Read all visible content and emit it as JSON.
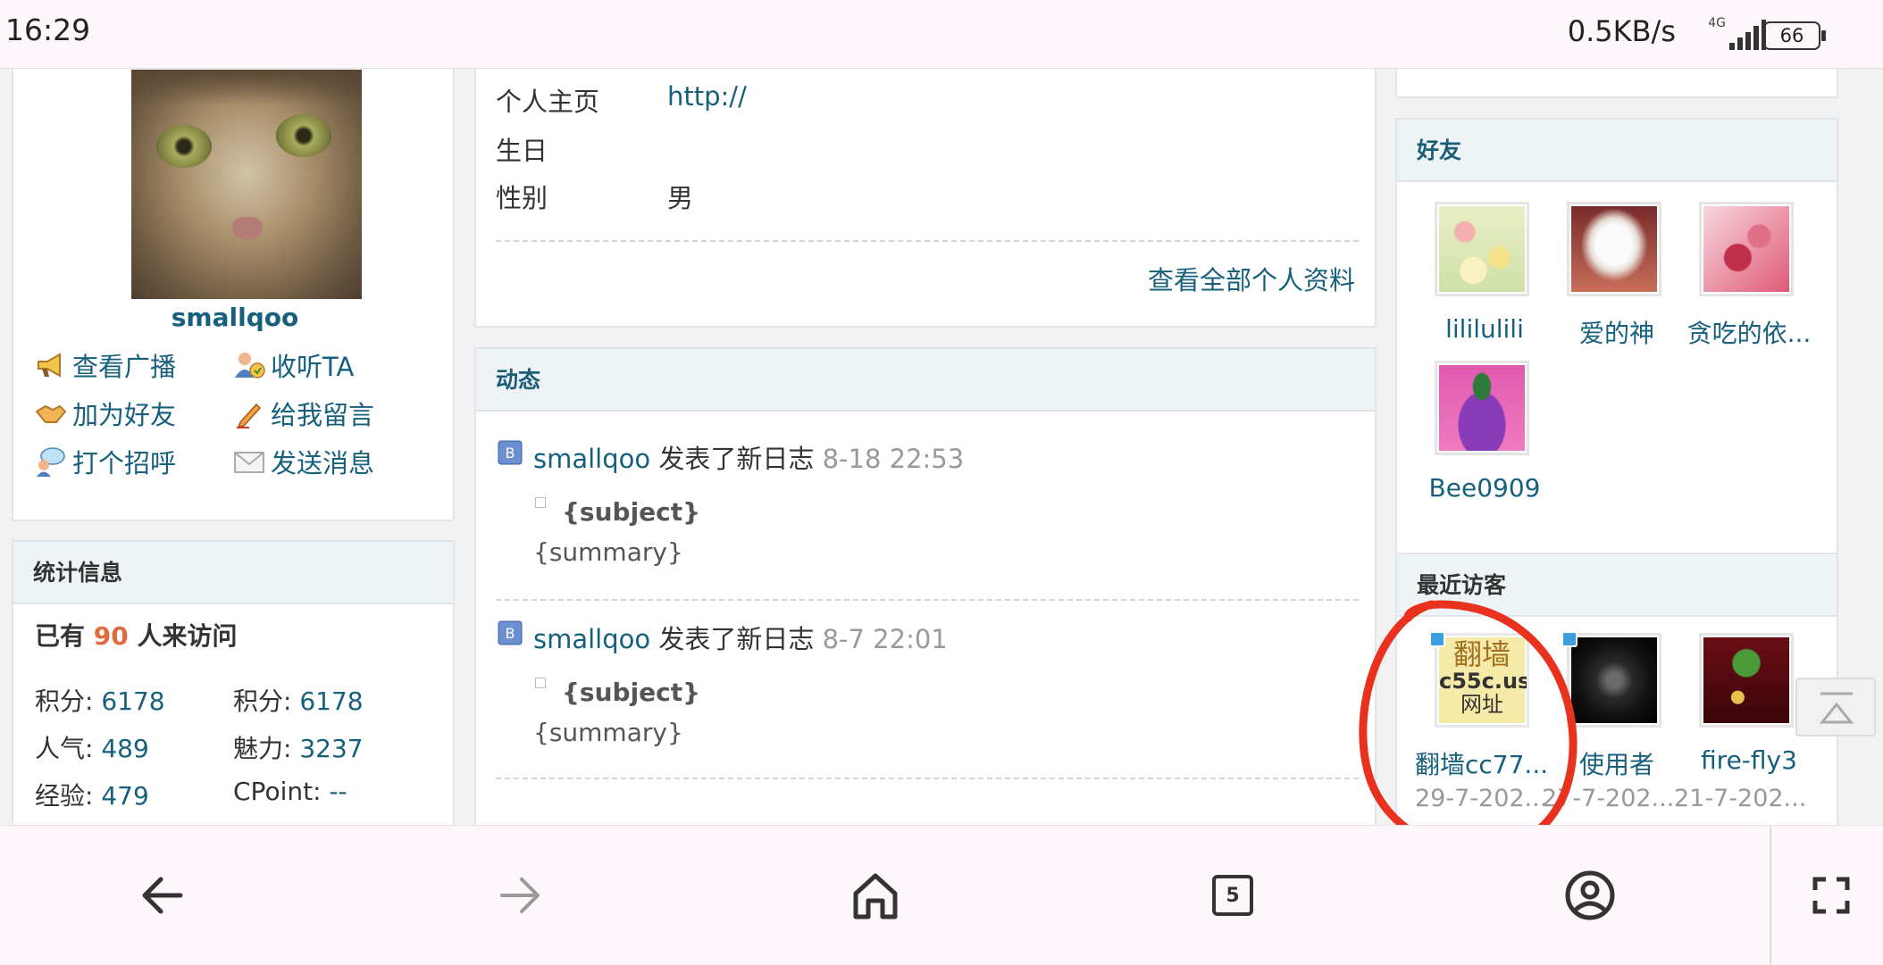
{
  "status_bar": {
    "time": "16:29",
    "speed": "0.5KB/s",
    "network": "4G",
    "battery": "66"
  },
  "profile": {
    "username": "smallqoo",
    "actions": [
      {
        "label": "查看广播",
        "icon": "megaphone-icon"
      },
      {
        "label": "收听TA",
        "icon": "listen-user-icon"
      },
      {
        "label": "加为好友",
        "icon": "handshake-icon"
      },
      {
        "label": "给我留言",
        "icon": "pencil-icon"
      },
      {
        "label": "打个招呼",
        "icon": "greet-bubble-icon"
      },
      {
        "label": "发送消息",
        "icon": "envelope-icon"
      }
    ]
  },
  "stats": {
    "title": "统计信息",
    "visitors_prefix": "已有",
    "visitors_count": "90",
    "visitors_suffix": "人来访问",
    "items": [
      {
        "label": "积分:",
        "value": "6178"
      },
      {
        "label": "积分:",
        "value": "6178"
      },
      {
        "label": "人气:",
        "value": "489"
      },
      {
        "label": "魅力:",
        "value": "3237"
      },
      {
        "label": "经验:",
        "value": "479"
      },
      {
        "label": "CPoint:",
        "value": "--"
      }
    ]
  },
  "info": {
    "rows": [
      {
        "label": "个人主页",
        "value": "http://"
      },
      {
        "label": "生日",
        "value": ""
      },
      {
        "label": "性别",
        "value": "男"
      }
    ],
    "view_all": "查看全部个人资料"
  },
  "feed": {
    "title": "动态",
    "items": [
      {
        "user": "smallqoo",
        "action": "发表了新日志",
        "time": "8-18 22:53",
        "subject": "{subject}",
        "summary": "{summary}"
      },
      {
        "user": "smallqoo",
        "action": "发表了新日志",
        "time": "8-7 22:01",
        "subject": "{subject}",
        "summary": "{summary}"
      }
    ]
  },
  "friends": {
    "title": "好友",
    "items": [
      {
        "name": "lililulili"
      },
      {
        "name": "爱的神"
      },
      {
        "name": "贪吃的依..."
      },
      {
        "name": "Bee0909"
      }
    ]
  },
  "visitors": {
    "title": "最近访客",
    "items": [
      {
        "name": "翻墙cc77...",
        "date": "29-7-202...",
        "thumb_text": [
          "翻墙",
          "c55c.us",
          "网址"
        ]
      },
      {
        "name": "使用者",
        "date": "27-7-202..."
      },
      {
        "name": "fire-fly3",
        "date": "21-7-202..."
      }
    ]
  },
  "navbar": {
    "tab_count": "5"
  },
  "colors": {
    "link": "#16607d",
    "accent_count": "#e06a3c",
    "annotation_circle": "#e8321e"
  }
}
